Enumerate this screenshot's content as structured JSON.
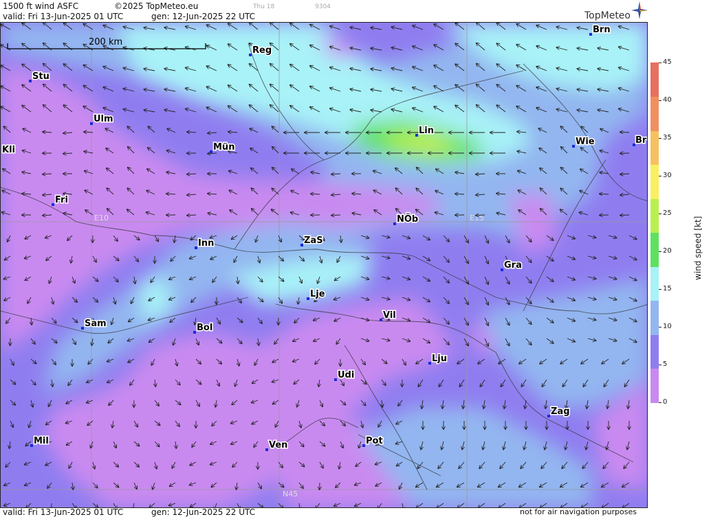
{
  "header": {
    "title": "1500 ft wind ASFC",
    "copyright": "©2025 TopMeteo.eu",
    "valid": "valid:  Fri  13-Jun-2025  01 UTC",
    "gen": "gen: 12-Jun-2025 22 UTC",
    "faint1": "Thu 18",
    "faint2": "9304"
  },
  "logo": {
    "text": "TopMeteo"
  },
  "footer": {
    "valid": "valid:  Fri  13-Jun-2025  01 UTC",
    "gen": "gen: 12-Jun-2025 22 UTC",
    "disclaimer": "not for air navigation purposes"
  },
  "scale_bar": {
    "label": "200 km"
  },
  "grid_labels": [
    "E10",
    "E15",
    "N45"
  ],
  "cities": [
    {
      "name": "Stu"
    },
    {
      "name": "Ulm"
    },
    {
      "name": "Kli"
    },
    {
      "name": "Mün"
    },
    {
      "name": "Reg"
    },
    {
      "name": "Brn"
    },
    {
      "name": "Lin"
    },
    {
      "name": "Wie"
    },
    {
      "name": "Br"
    },
    {
      "name": "Fri"
    },
    {
      "name": "NÖb"
    },
    {
      "name": "Inn"
    },
    {
      "name": "ZaS"
    },
    {
      "name": "Gra"
    },
    {
      "name": "Lje"
    },
    {
      "name": "Vil"
    },
    {
      "name": "Sam"
    },
    {
      "name": "Bol"
    },
    {
      "name": "Lju"
    },
    {
      "name": "Udi"
    },
    {
      "name": "Zag"
    },
    {
      "name": "Mil"
    },
    {
      "name": "Ven"
    },
    {
      "name": "Pot"
    }
  ],
  "colorbar": {
    "title": "wind  speed  [kt]",
    "ticks": [
      "45",
      "40",
      "35",
      "30",
      "25",
      "20",
      "15",
      "10",
      "5",
      "0"
    ],
    "colors": [
      "#c98af0",
      "#8f7df0",
      "#93b6f0",
      "#a8f2f8",
      "#5fe060",
      "#b8f050",
      "#f8f060",
      "#f8c060",
      "#f09060",
      "#e87060"
    ]
  }
}
